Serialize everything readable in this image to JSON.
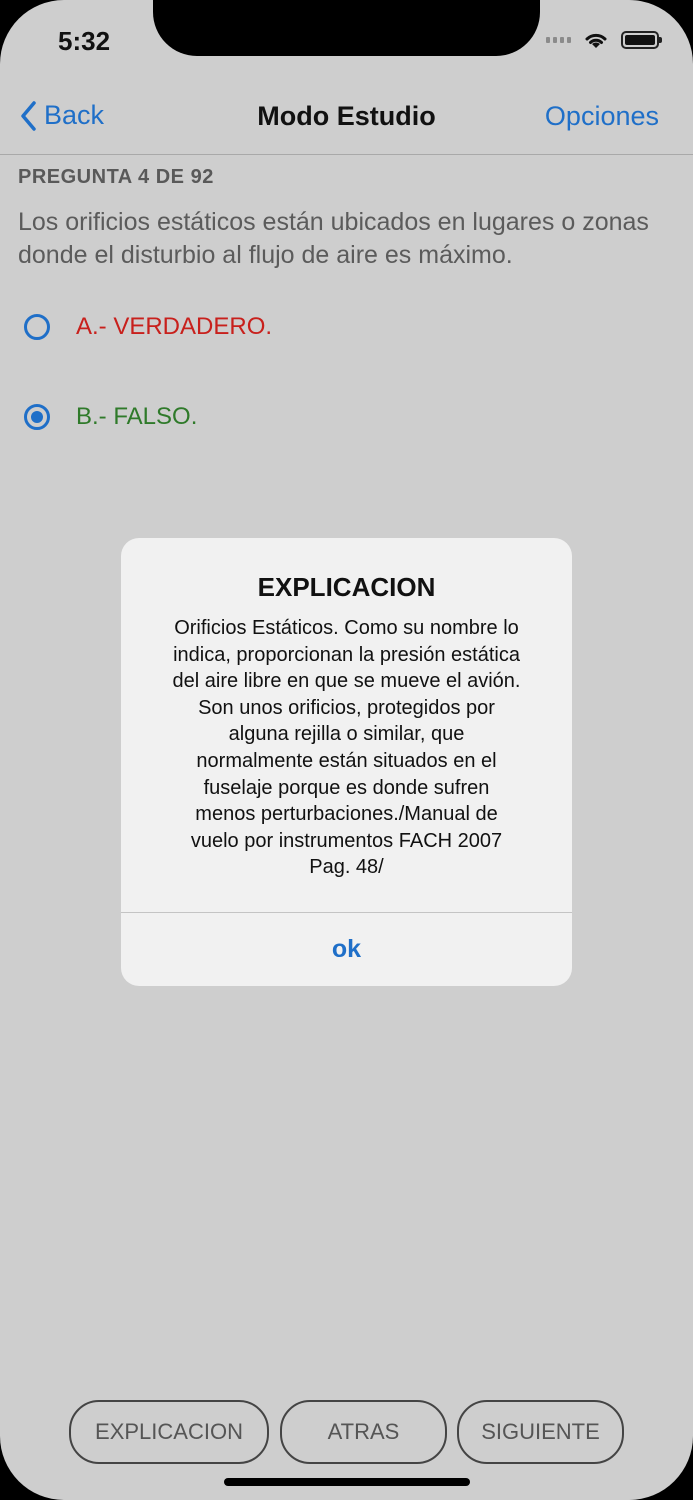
{
  "status_bar": {
    "time": "5:32"
  },
  "nav": {
    "back_label": "Back",
    "title": "Modo Estudio",
    "options_label": "Opciones"
  },
  "question": {
    "counter": "PREGUNTA 4 DE 92",
    "text": "Los orificios estáticos están ubicados en lugares o zonas donde el disturbio al flujo de aire es máximo."
  },
  "options": [
    {
      "label": "A.- VERDADERO.",
      "color": "#c8201c",
      "selected": false
    },
    {
      "label": "B.- FALSO.",
      "color": "#2f7a2a",
      "selected": true
    }
  ],
  "dialog": {
    "title": "EXPLICACION",
    "lines": [
      "Orificios Estáticos. Como su nombre lo",
      "indica, proporcionan la presión estática",
      "del aire libre en que se mueve el avión.",
      "Son unos orificios, protegidos por",
      "alguna rejilla o similar, que",
      "normalmente están situados en el",
      "fuselaje porque es donde sufren",
      "menos perturbaciones./Manual de",
      "vuelo por instrumentos FACH 2007",
      "Pag. 48/"
    ],
    "ok_label": "ok"
  },
  "bottom_buttons": {
    "explicacion": "EXPLICACION",
    "atras": "ATRAS",
    "siguiente": "SIGUIENTE"
  },
  "colors": {
    "accent": "#1f6fc8",
    "background": "#cecece",
    "dialog_bg": "#f1f1f1"
  }
}
